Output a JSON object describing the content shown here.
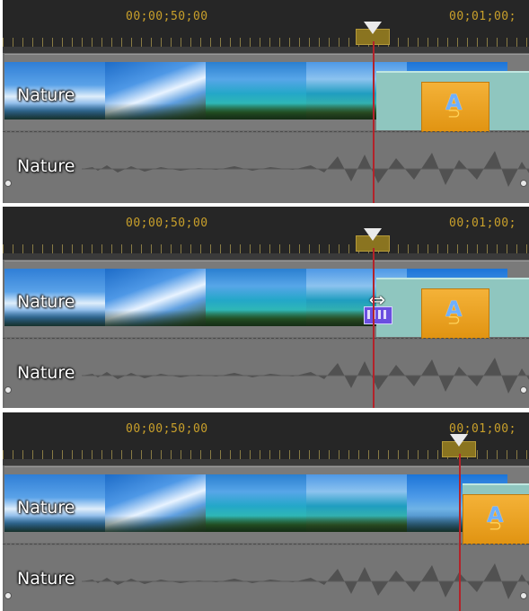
{
  "ruler": {
    "tc_left": "00;00;50;00",
    "tc_right": "00;01;00;"
  },
  "tracks": {
    "video_clip_label": "Nature",
    "audio_clip_label": "Nature"
  },
  "colors": {
    "timecode": "#c9a02b",
    "playhead_line": "#b3232a",
    "transition_tile": "#f4b238",
    "transition_region": "#8fc6bf"
  },
  "icons": {
    "playhead": "playhead-marker-icon",
    "transition": "transition-A-icon",
    "trim_cursor": "trim-resize-cursor-icon"
  }
}
